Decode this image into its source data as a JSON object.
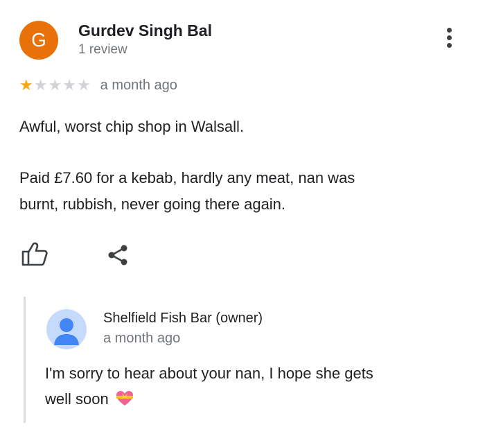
{
  "review": {
    "author_initial": "G",
    "author_name": "Gurdev Singh Bal",
    "author_meta": "1 review",
    "rating": 1,
    "rating_max": 5,
    "time": "a month ago",
    "text_paragraph_1": "Awful, worst chip shop in Walsall.",
    "text_paragraph_2_line_1": "Paid £7.60 for a kebab, hardly any meat, nan was",
    "text_paragraph_2_line_2": "burnt, rubbish, never going there again."
  },
  "actions": {
    "like_icon": "thumbs-up-icon",
    "share_icon": "share-icon",
    "more_icon": "more-vertical-icon"
  },
  "owner_reply": {
    "name": "Shelfield Fish Bar (owner)",
    "time": "a month ago",
    "text_line_1": "I'm sorry to hear about your nan, I hope she gets",
    "text_line_2": "well soon",
    "emoji": "heart-with-ribbon-icon"
  },
  "colors": {
    "avatar_bg": "#e8710a",
    "star_on": "#f4a814",
    "star_off": "#d2d3d6",
    "meta_text": "#70757a",
    "owner_avatar_bg": "#c6dafc",
    "owner_avatar_person": "#4285f4"
  }
}
